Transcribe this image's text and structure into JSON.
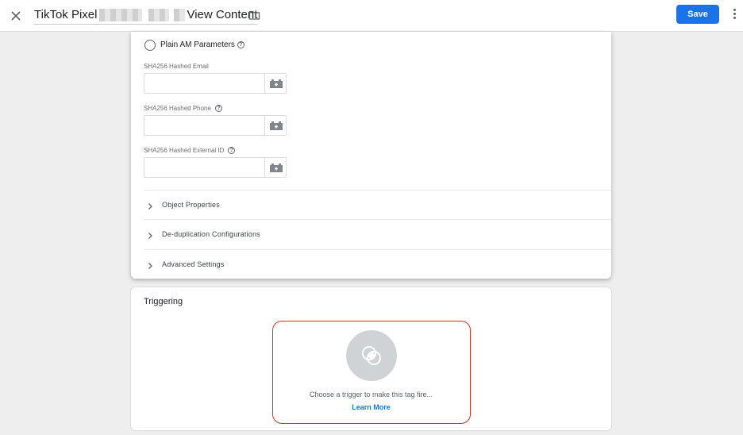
{
  "header": {
    "title_prefix": "TikTok Pixel",
    "title_suffix": "View Content",
    "save_label": "Save"
  },
  "config": {
    "radio_label": "Plain AM Parameters",
    "fields": [
      {
        "label": "SHA256 Hashed Email",
        "value": "",
        "has_help": false
      },
      {
        "label": "SHA256 Hashed Phone",
        "value": "",
        "has_help": true
      },
      {
        "label": "SHA256 Hashed External ID",
        "value": "",
        "has_help": true
      }
    ],
    "sections": [
      {
        "label": "Object Properties"
      },
      {
        "label": "De-duplication Configurations"
      },
      {
        "label": "Advanced Settings"
      }
    ]
  },
  "triggering": {
    "title": "Triggering",
    "hint": "Choose a trigger to make this tag fire...",
    "learn_more": "Learn More"
  },
  "colors": {
    "accent": "#1a73e8",
    "highlight_border": "#d93025",
    "background": "#eeeeee"
  },
  "icons": [
    "close-icon",
    "folder-icon",
    "more-vert-icon",
    "help-icon",
    "variable-icon",
    "chevron-right-icon",
    "trigger-icon"
  ]
}
